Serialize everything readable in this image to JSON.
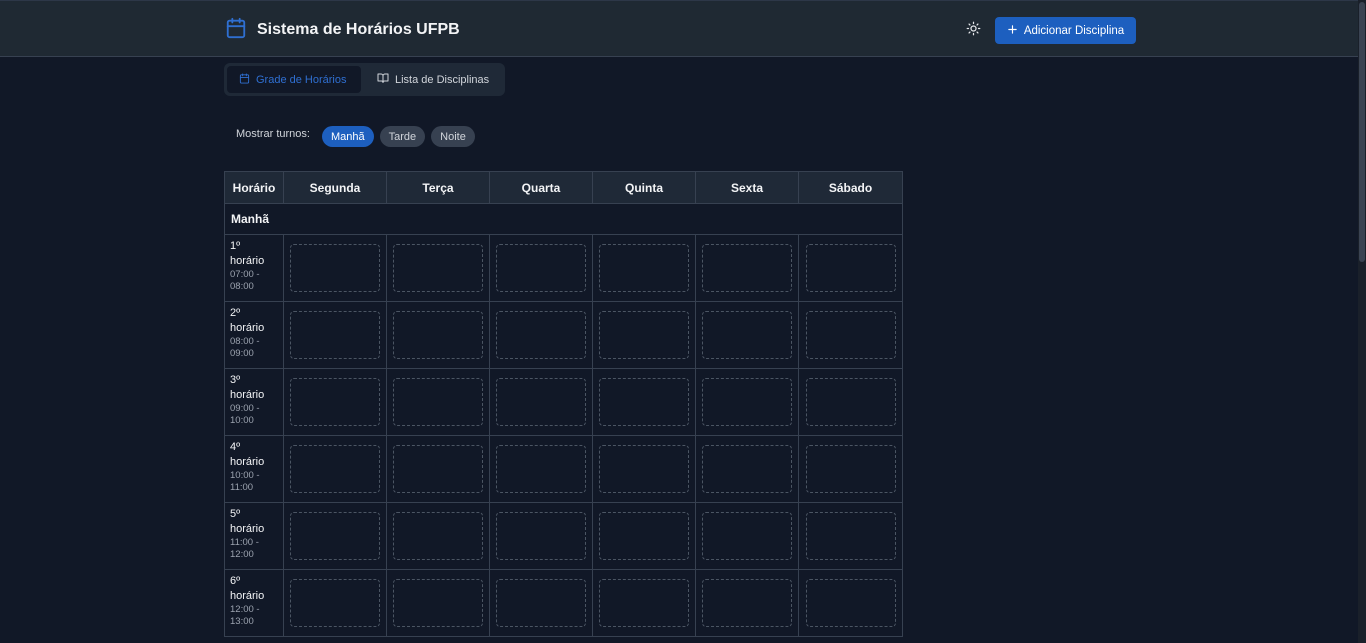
{
  "header": {
    "title": "Sistema de Horários UFPB",
    "theme_toggle_icon": "sun-icon",
    "add_button_label": "Adicionar Disciplina"
  },
  "tabs": [
    {
      "label": "Grade de Horários",
      "icon": "calendar-icon",
      "active": true
    },
    {
      "label": "Lista de Disciplinas",
      "icon": "book-open-icon",
      "active": false
    }
  ],
  "turnos": {
    "label": "Mostrar turnos:",
    "options": [
      {
        "label": "Manhã",
        "selected": true
      },
      {
        "label": "Tarde",
        "selected": false
      },
      {
        "label": "Noite",
        "selected": false
      }
    ]
  },
  "grid": {
    "columns": [
      "Horário",
      "Segunda",
      "Terça",
      "Quarta",
      "Quinta",
      "Sexta",
      "Sábado"
    ],
    "section": "Manhã",
    "slots": [
      {
        "num": "1º",
        "word": "horário",
        "t1": "07:00 -",
        "t2": "08:00"
      },
      {
        "num": "2º",
        "word": "horário",
        "t1": "08:00 -",
        "t2": "09:00"
      },
      {
        "num": "3º",
        "word": "horário",
        "t1": "09:00 -",
        "t2": "10:00"
      },
      {
        "num": "4º",
        "word": "horário",
        "t1": "10:00 -",
        "t2": "11:00"
      },
      {
        "num": "5º",
        "word": "horário",
        "t1": "11:00 -",
        "t2": "12:00"
      },
      {
        "num": "6º",
        "word": "horário",
        "t1": "12:00 -",
        "t2": "13:00"
      }
    ]
  },
  "colors": {
    "accent": "#1d5fbf",
    "background": "#111827",
    "header_bg": "#1f2933"
  }
}
